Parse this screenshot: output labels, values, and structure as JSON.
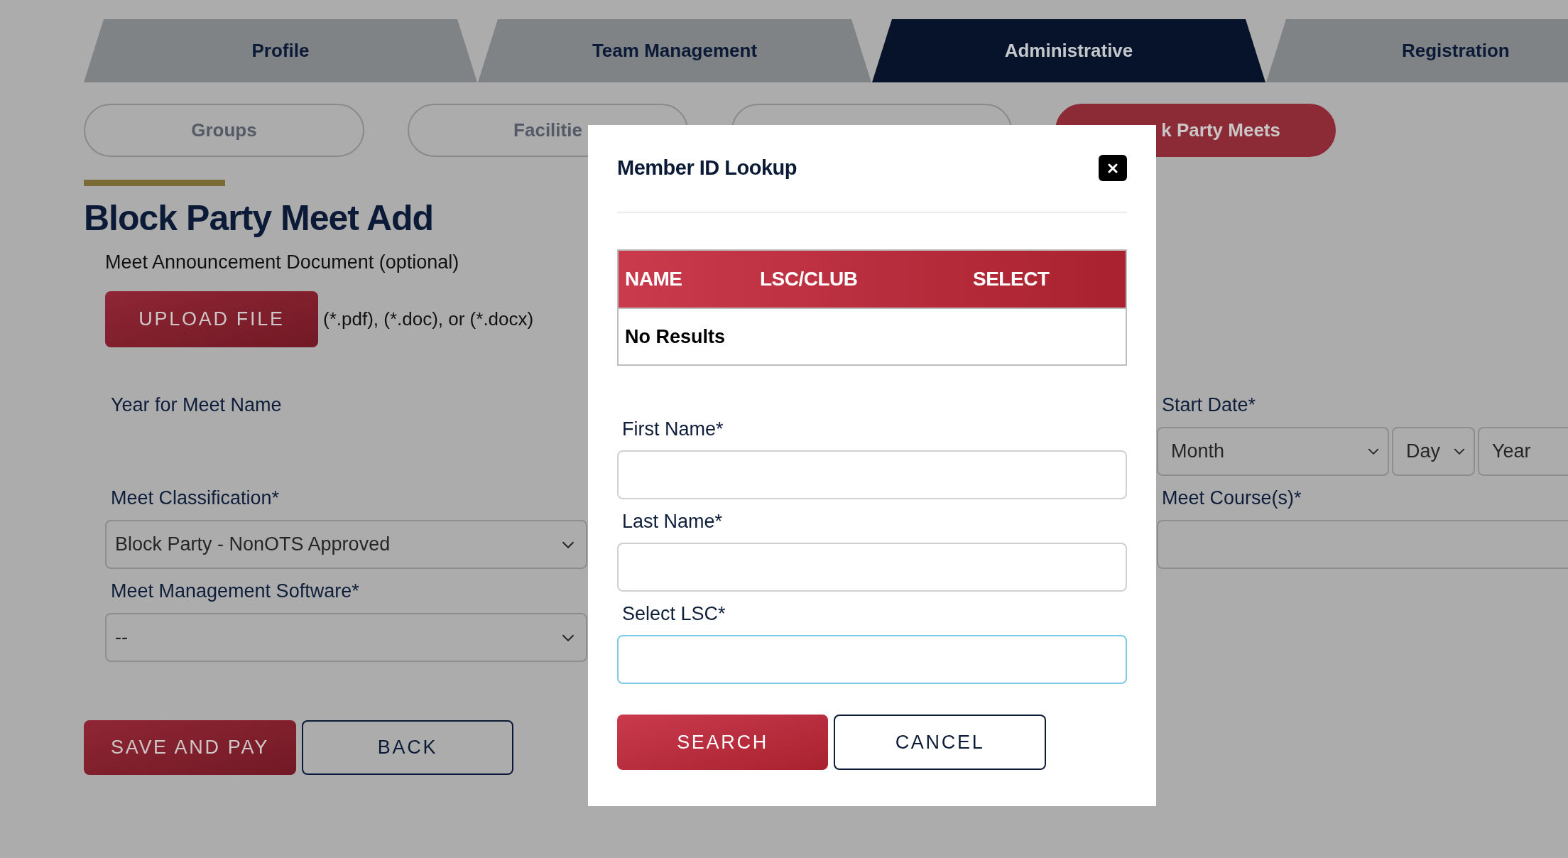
{
  "main_tabs": [
    {
      "label": "Profile",
      "selected": false
    },
    {
      "label": "Team Management",
      "selected": false
    },
    {
      "label": "Administrative",
      "selected": true
    },
    {
      "label": "Registration",
      "selected": false
    }
  ],
  "sub_tabs": [
    {
      "label": "Groups",
      "selected": false
    },
    {
      "label": "Facilitie",
      "selected": false
    },
    {
      "selected": false
    },
    {
      "label": "k Party Meets",
      "selected": true
    }
  ],
  "page": {
    "title": "Block Party Meet Add",
    "upload": {
      "label": "Meet Announcement Document (optional)",
      "button": "UPLOAD FILE",
      "hint": "(*.pdf), (*.doc), or (*.docx)"
    },
    "left_fields": [
      {
        "kind": "label",
        "label": "Year for Meet Name"
      },
      {
        "kind": "select",
        "label": "Meet Classification*",
        "value": "Block Party - NonOTS Approved"
      },
      {
        "kind": "select",
        "label": "Meet Management Software*",
        "value": "--"
      }
    ],
    "right_fields": [
      {
        "kind": "date",
        "label": "Start Date*",
        "parts": [
          "Month",
          "Day",
          "Year"
        ]
      },
      {
        "kind": "input",
        "label": "Meet Course(s)*"
      }
    ],
    "save_button": "SAVE AND PAY",
    "back_button": "BACK"
  },
  "modal": {
    "title": "Member ID Lookup",
    "table": {
      "columns": [
        "NAME",
        "LSC/CLUB",
        "SELECT"
      ],
      "empty_message": "No Results"
    },
    "fields": [
      {
        "label": "First Name*",
        "focused": false
      },
      {
        "label": "Last Name*",
        "focused": false
      },
      {
        "label": "Select LSC*",
        "focused": true
      }
    ],
    "search_button": "SEARCH",
    "cancel_button": "CANCEL"
  }
}
